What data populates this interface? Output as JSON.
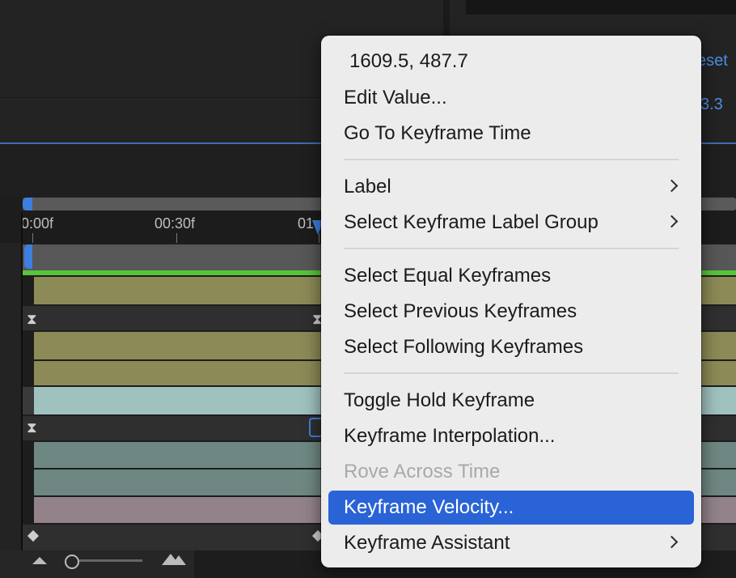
{
  "panel": {
    "reset_partial": "eset",
    "value_partial": "3.3"
  },
  "timeline": {
    "ruler_labels": [
      "0:00f",
      "00:30f",
      "01"
    ]
  },
  "colors": {
    "accent_blue": "#3d7fe0",
    "menu_selected": "#2a63d6",
    "track_olive": "#8c8a56",
    "track_aqua": "#9fc2bf",
    "track_teal": "#6f8782",
    "track_mauve": "#93828a",
    "track_green_line": "#57c43c"
  },
  "context_menu": {
    "coord_value": "1609.5, 487.7",
    "items": [
      {
        "label": "Edit Value...",
        "enabled": true
      },
      {
        "label": "Go To Keyframe Time",
        "enabled": true
      },
      {
        "label": "Label",
        "enabled": true,
        "submenu": true
      },
      {
        "label": "Select Keyframe Label Group",
        "enabled": true,
        "submenu": true
      },
      {
        "label": "Select Equal Keyframes",
        "enabled": true
      },
      {
        "label": "Select Previous Keyframes",
        "enabled": true
      },
      {
        "label": "Select Following Keyframes",
        "enabled": true
      },
      {
        "label": "Toggle Hold Keyframe",
        "enabled": true
      },
      {
        "label": "Keyframe Interpolation...",
        "enabled": true
      },
      {
        "label": "Rove Across Time",
        "enabled": false
      },
      {
        "label": "Keyframe Velocity...",
        "enabled": true,
        "selected": true
      },
      {
        "label": "Keyframe Assistant",
        "enabled": true,
        "submenu": true
      }
    ]
  }
}
